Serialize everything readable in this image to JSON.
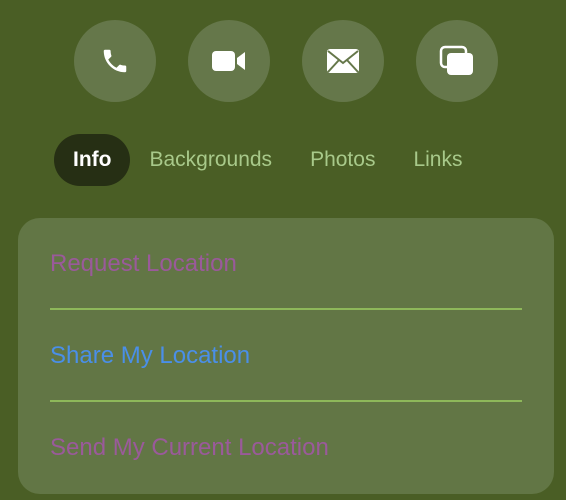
{
  "actions": [
    {
      "icon": "phone-icon"
    },
    {
      "icon": "video-camera-icon"
    },
    {
      "icon": "mail-icon"
    },
    {
      "icon": "screen-share-icon"
    }
  ],
  "tabs": [
    {
      "label": "Info",
      "active": true
    },
    {
      "label": "Backgrounds",
      "active": false
    },
    {
      "label": "Photos",
      "active": false
    },
    {
      "label": "Links",
      "active": false
    }
  ],
  "location": {
    "items": [
      {
        "label": "Request Location",
        "state": "disabled"
      },
      {
        "label": "Share My Location",
        "state": "enabled"
      },
      {
        "label": "Send My Current Location",
        "state": "disabled"
      }
    ]
  },
  "colors": {
    "background": "#4a5e25",
    "button_bg": "#65774a",
    "card_bg": "#627645",
    "active_tab_bg": "#262f14",
    "tab_text": "#a8c98a",
    "divider": "#8eb85a",
    "link_blue": "#4a8fe8",
    "disabled_purple": "#9a5a9a"
  }
}
